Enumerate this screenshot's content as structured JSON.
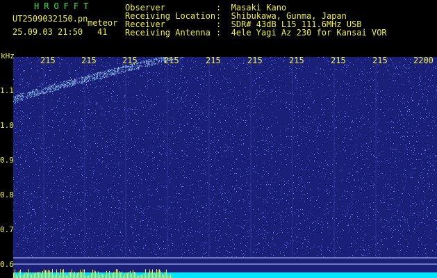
{
  "header": {
    "logo": "HROFFT",
    "filename": "UT2509032150.pn",
    "tag": "meteor",
    "datetime": "25.09.03 21:50",
    "count": "41",
    "observer_key": "Observer",
    "observer_val": ":  Masaki Kano",
    "location_key": "Receiving Location",
    "location_val": ":  Shibukawa, Gunma, Japan",
    "receiver_key": "Receiver",
    "receiver_val": ":  SDR# 43dB L15 111.6MHz USB",
    "antenna_key": "Receiving Antenna",
    "antenna_val": ":  4ele Yagi Az 230 for Kansai VOR"
  },
  "axis": {
    "unit": "kHz",
    "x_ticks": [
      "215",
      "215",
      "215",
      "215",
      "215",
      "215",
      "215",
      "215",
      "215",
      "2200"
    ],
    "y_ticks": [
      "1.1",
      "1.0",
      "0.9",
      "0.8",
      "0.7",
      "0.6"
    ]
  },
  "colors": {
    "background": "#1a1f78",
    "speckle": "#5a6cf0",
    "meteor": "#9fd4ff",
    "baseline": "#00e5ff",
    "spike": "#f2f23a",
    "label": "#f2f23a",
    "logo": "#3ee83e"
  }
}
